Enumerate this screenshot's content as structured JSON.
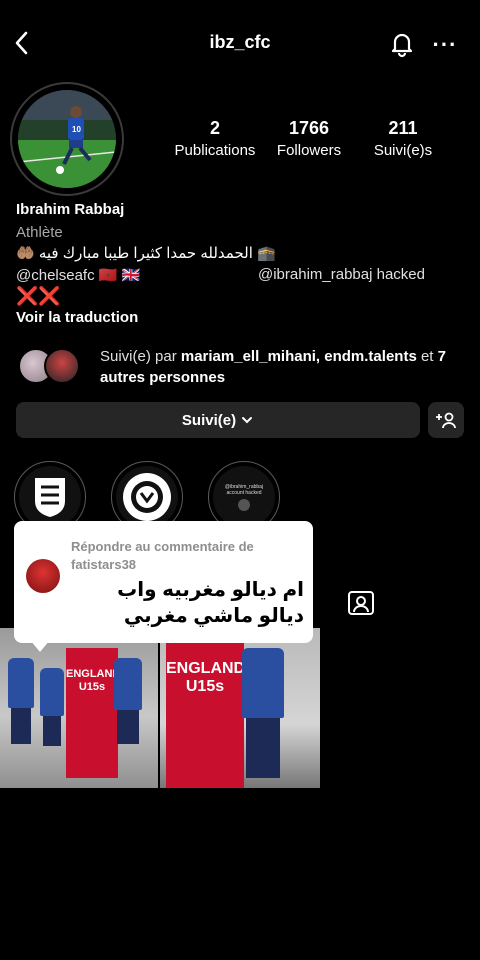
{
  "header": {
    "back_icon": "chevron-left-icon",
    "username": "ibz_cfc",
    "bell_icon": "bell-icon",
    "more_label": "···"
  },
  "stats": [
    {
      "value": "2",
      "label": "Publications"
    },
    {
      "value": "1766",
      "label": "Followers"
    },
    {
      "value": "211",
      "label": "Suivi(e)s"
    }
  ],
  "profile": {
    "name": "Ibrahim Rabbaj",
    "category": "Athlète",
    "bio_line1": "🤲🏽 الحمدلله حمدا كثيرا طيبا مبارك فيه 🕋",
    "bio_mention1": "@chelseafc 🇲🇦 🇬🇧",
    "bio_mention2": "@ibrahim_rabbaj  hacked",
    "bio_marks": "❌❌",
    "translate_label": "Voir la traduction"
  },
  "mutual": {
    "prefix": "Suivi(e) par ",
    "names": "mariam_ell_mihani, endm.talents",
    "middle": " et ",
    "others": "7 autres personnes"
  },
  "actions": {
    "follow_label": "Suivi(e)",
    "add_user_label": "+👤"
  },
  "highlights": [
    "england-crest",
    "germany-crest",
    "account-screenshot"
  ],
  "highlight3_text": "@ibrahim_rabbaj account hacked",
  "popup": {
    "header": "Répondre au commentaire de fatistars38",
    "text": "ام ديالو مغربيه واب ديالو ماشي مغربي"
  },
  "posts": [
    {
      "banner": "ENGLAND U15s"
    },
    {
      "banner": "ENGLAND U15s"
    }
  ],
  "colors": {
    "bg": "#000000",
    "button": "#262626",
    "accent_red": "#c8102e"
  }
}
